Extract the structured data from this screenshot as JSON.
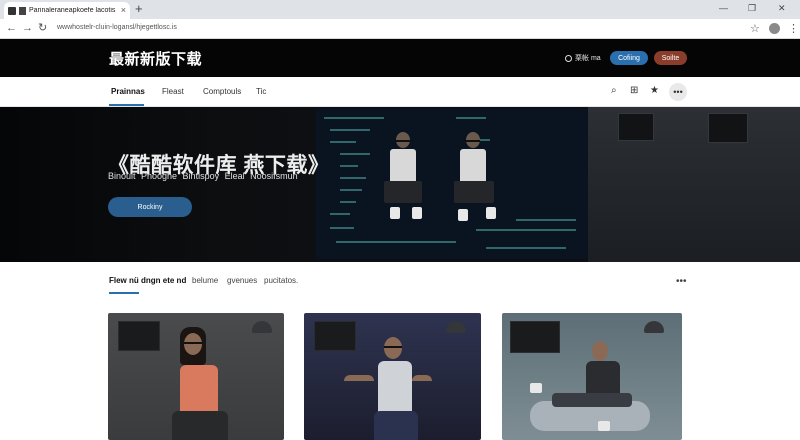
{
  "browser": {
    "tab_title": "Parinaleraneapkoefe lacotis",
    "tab_close": "×",
    "new_tab": "+",
    "url": "wwwhostelr-cluin-logansl/hjegettlosc.is",
    "controls": {
      "minimize": "—",
      "maximize": "❐",
      "close": "✕"
    },
    "nav": {
      "back": "←",
      "forward": "→",
      "reload": "↻",
      "star": "☆",
      "menu": "⋮"
    }
  },
  "header": {
    "logo": "最新新版下载",
    "lang_label": "栗帐 ma",
    "btn_primary": "Cofiing",
    "btn_secondary": "Soilte"
  },
  "nav": {
    "tabs": [
      {
        "label": "Prainnas",
        "active": true
      },
      {
        "label": "Fleast",
        "active": false
      },
      {
        "label": "Comptouls",
        "active": false
      },
      {
        "label": "Tic",
        "active": false
      }
    ],
    "icons": {
      "search": "⌕",
      "grid": "⊞",
      "star": "★",
      "more": "•••"
    }
  },
  "hero": {
    "title": "《酷酷软件库 燕下载》",
    "subtitle": "Binoult Pnooghe Bintispoy Eleal Noosifsmun",
    "cta": "Rockiny"
  },
  "section": {
    "tabs": [
      {
        "label": "Flew nü dngn ete nd",
        "active": true
      },
      {
        "label": "belume",
        "active": false
      },
      {
        "label": "gvenues",
        "active": false
      },
      {
        "label": "pucitatos.",
        "active": false
      }
    ],
    "more": "•••"
  },
  "colors": {
    "accent": "#2a6fae",
    "secondary": "#8b3d2c",
    "header_bg": "#050505"
  }
}
